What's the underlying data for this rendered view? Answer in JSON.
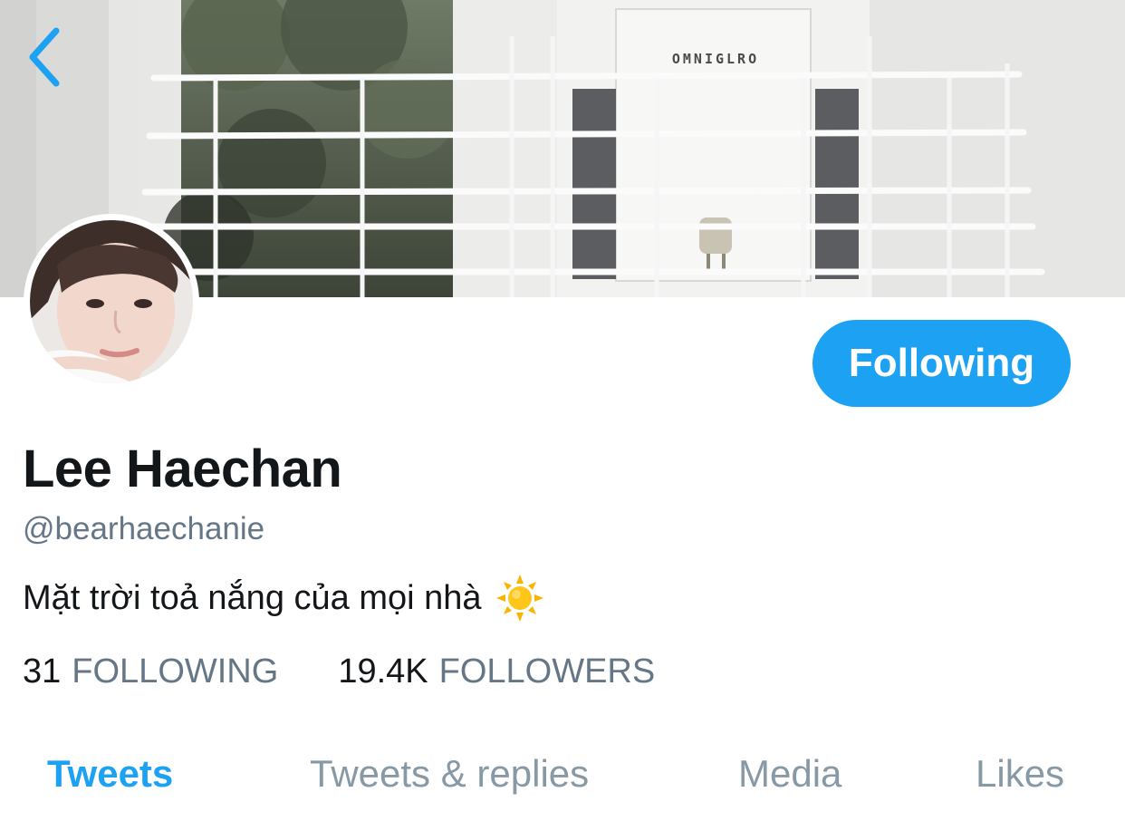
{
  "header": {
    "back_icon": "chevron-left-icon",
    "brand_sign": "OMNIGLRO"
  },
  "profile": {
    "display_name": "Lee Haechan",
    "handle": "@bearhaechanie",
    "bio": "Mặt trời toả nắng của mọi nhà",
    "bio_emoji": "sun-icon",
    "follow_label": "Following"
  },
  "stats": [
    {
      "count": "31",
      "label": "FOLLOWING"
    },
    {
      "count": "19.4K",
      "label": "FOLLOWERS"
    }
  ],
  "tabs": [
    {
      "label": "Tweets",
      "active": true
    },
    {
      "label": "Tweets & replies",
      "active": false
    },
    {
      "label": "Media",
      "active": false
    },
    {
      "label": "Likes",
      "active": false
    }
  ],
  "colors": {
    "accent": "#1da1f2",
    "text_primary": "#14171a",
    "text_secondary": "#657786",
    "tab_inactive": "#8899a6"
  }
}
